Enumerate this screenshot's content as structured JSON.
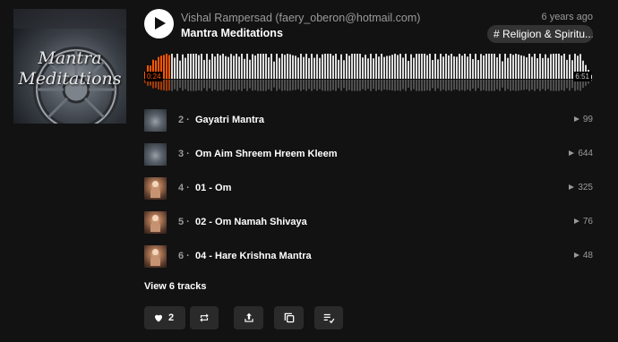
{
  "artwork": {
    "line1": "Mantra",
    "line2": "Meditations"
  },
  "header": {
    "uploader": "Vishal Rampersad (faery_oberon@hotmail.com)",
    "title": "Mantra Meditations",
    "time_ago": "6 years ago",
    "tag": "# Religion & Spiritu..."
  },
  "player": {
    "current_time": "0:24",
    "duration": "6:51",
    "progress": 0.058,
    "played_color": "#ff5500",
    "unplayed_color": "#dddddd"
  },
  "tracks": [
    {
      "number": "2",
      "name": "Gayatri Mantra",
      "plays": "99",
      "thumb": "mantra-artwork"
    },
    {
      "number": "3",
      "name": "Om Aim Shreem Hreem Kleem",
      "plays": "644",
      "thumb": "mantra-artwork"
    },
    {
      "number": "4",
      "name": "01 - Om",
      "plays": "325",
      "thumb": "saint-photo"
    },
    {
      "number": "5",
      "name": "02 - Om Namah Shivaya",
      "plays": "76",
      "thumb": "saint-photo"
    },
    {
      "number": "6",
      "name": "04 - Hare Krishna Mantra",
      "plays": "48",
      "thumb": "saint-photo"
    }
  ],
  "view_all": "View 6 tracks",
  "actions": {
    "like_count": "2",
    "icons": [
      "heart-icon",
      "repost-icon",
      "share-icon",
      "copy-link-icon",
      "add-to-queue-icon"
    ]
  }
}
